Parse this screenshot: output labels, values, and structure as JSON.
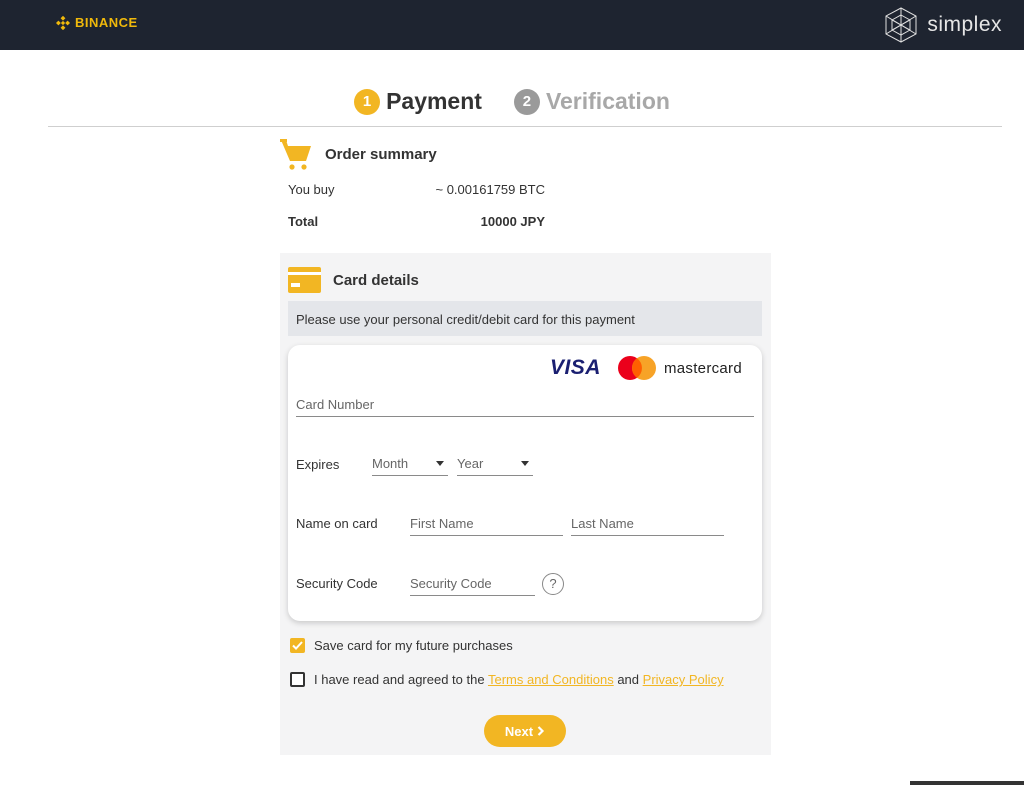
{
  "header": {
    "binance_logo_text": "BINANCE",
    "simplex_logo_text": "simplex"
  },
  "steps": [
    {
      "number": "1",
      "label": "Payment",
      "state": "active"
    },
    {
      "number": "2",
      "label": "Verification",
      "state": "inactive"
    }
  ],
  "order_summary": {
    "title": "Order summary",
    "rows": [
      {
        "label": "You buy",
        "value": "~ 0.00161759 BTC"
      },
      {
        "label": "Total",
        "value": "10000 JPY"
      }
    ]
  },
  "card_details": {
    "title": "Card details",
    "notice": "Please use your personal credit/debit card for this payment",
    "brands": {
      "visa": "VISA",
      "mastercard": "mastercard"
    },
    "card_number_placeholder": "Card Number",
    "expires_label": "Expires",
    "month_selected": "Month",
    "year_selected": "Year",
    "name_label": "Name on card",
    "first_name_placeholder": "First Name",
    "last_name_placeholder": "Last Name",
    "security_label": "Security Code",
    "security_placeholder": "Security Code",
    "help_glyph": "?"
  },
  "options": {
    "save_card": {
      "label": "Save card for my future purchases",
      "checked": true
    },
    "terms": {
      "prefix": "I have read and agreed to the",
      "terms_link": "Terms and Conditions",
      "conjunction": "and",
      "privacy_link": "Privacy Policy",
      "checked": false
    }
  },
  "next_button": {
    "label": "Next",
    "icon": "chevron-right-icon"
  },
  "colors": {
    "accent": "#f2b623",
    "topbar": "#1e2430",
    "binance_gold": "#f0b90b",
    "visa_blue": "#1a1f71",
    "mastercard_red": "#eb001b",
    "mastercard_orange": "#f79e1b"
  }
}
